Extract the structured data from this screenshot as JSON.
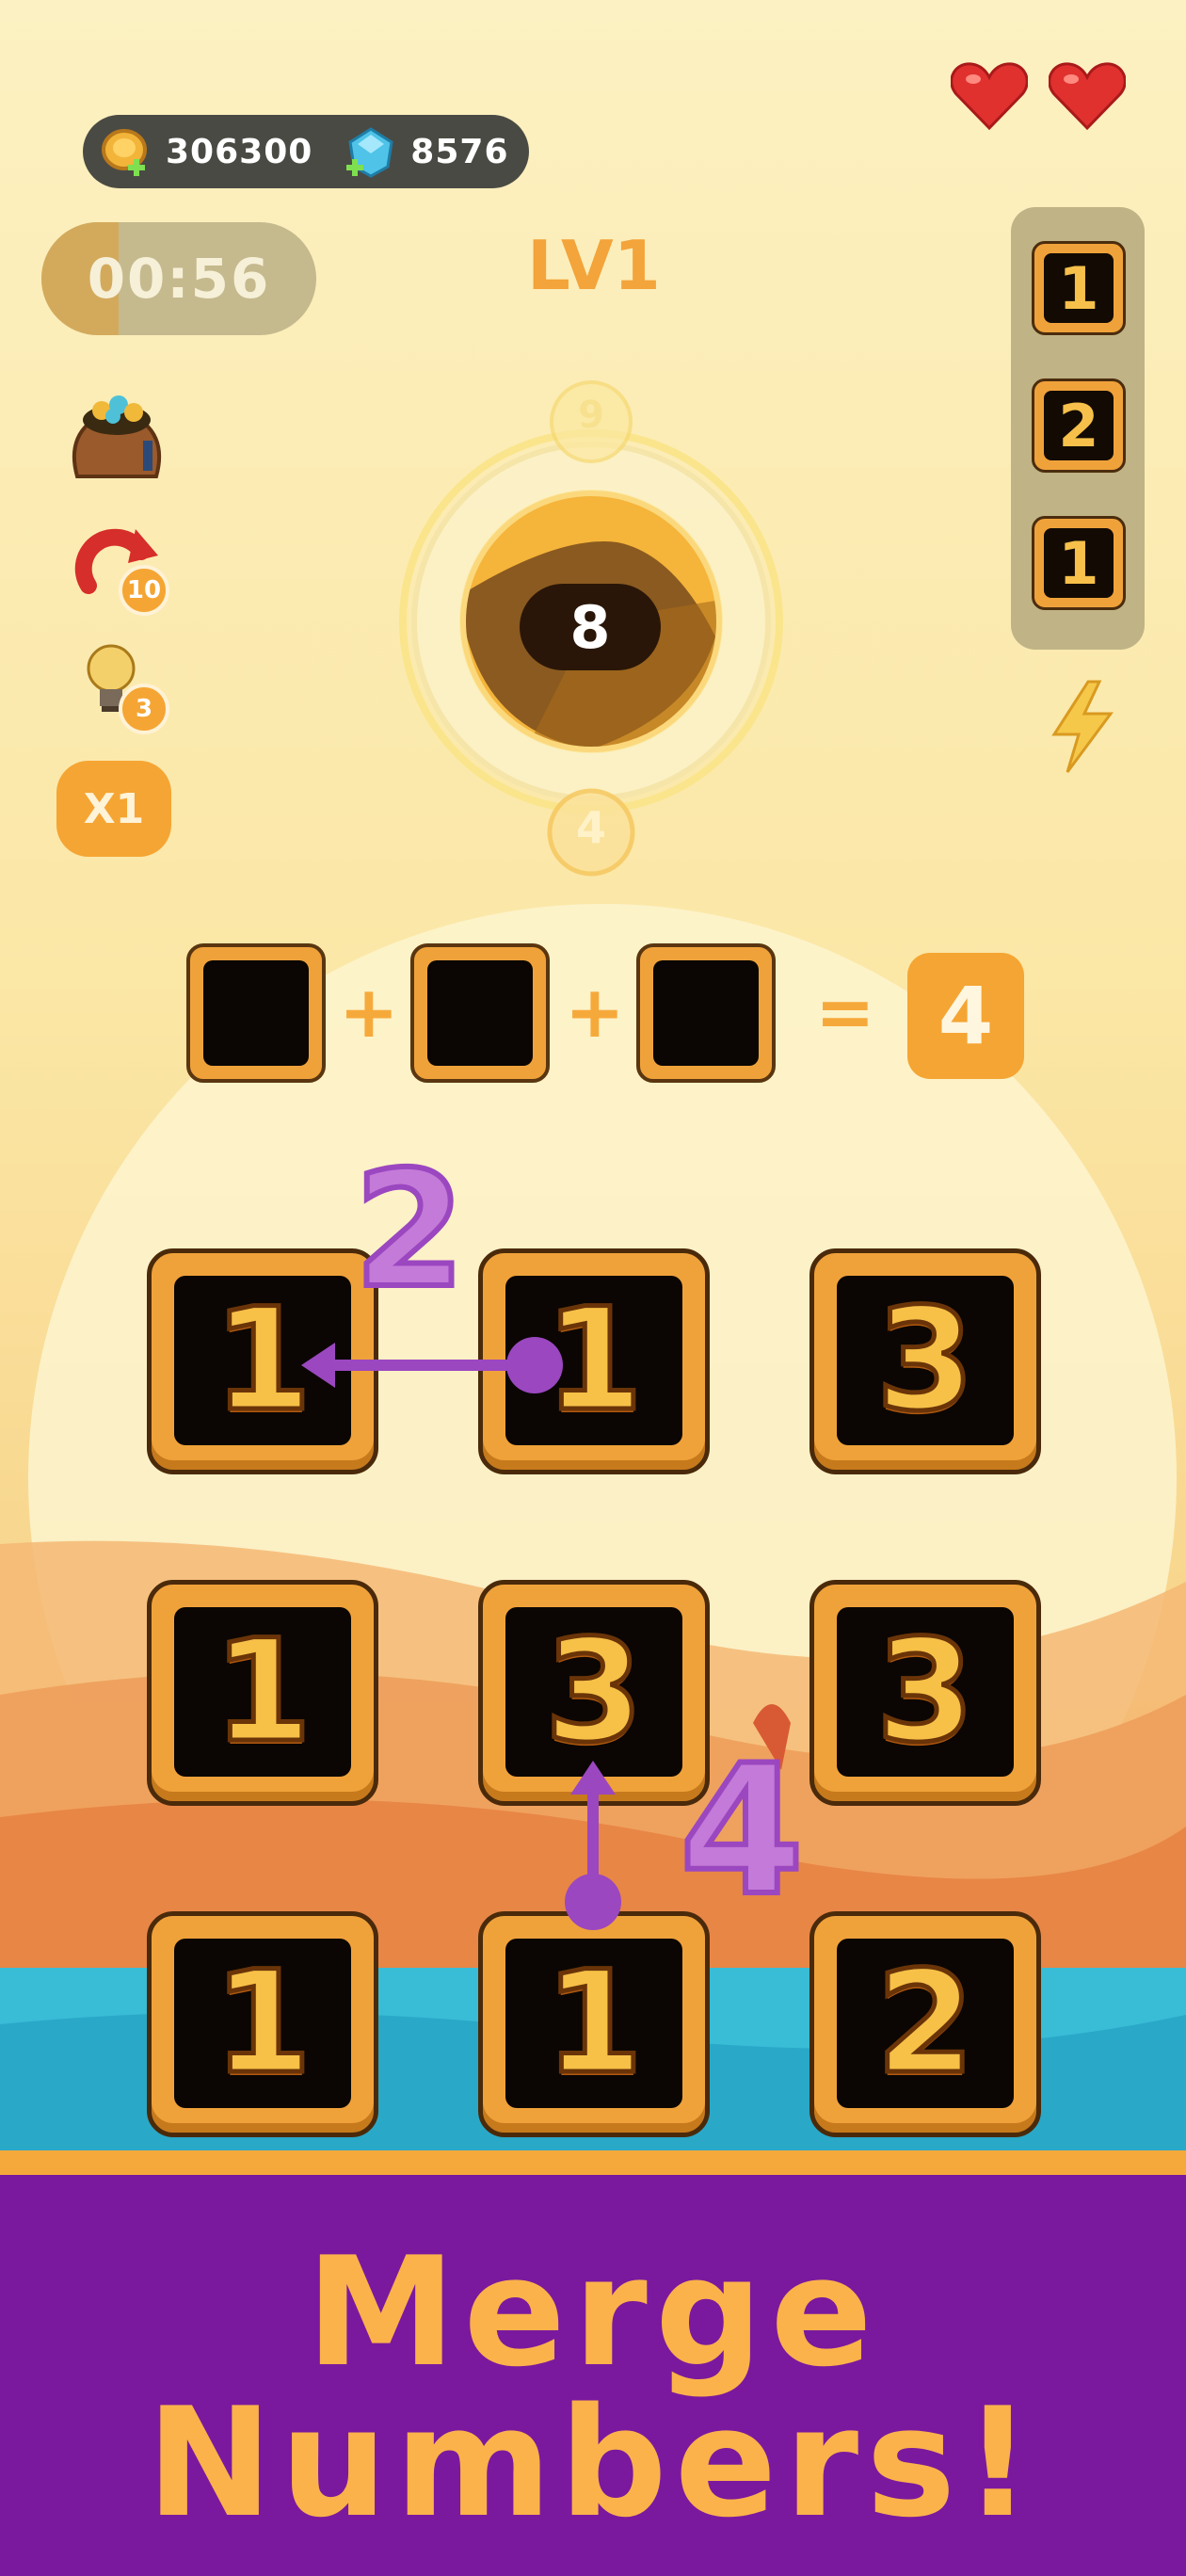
{
  "hud": {
    "coins": "306300",
    "gems": "8576",
    "timer": "00:56",
    "timer_progress": 0.28,
    "level": "LV1",
    "lives": 2
  },
  "powerups": {
    "bag_icon": "treasure-bag-icon",
    "undo_icon": "undo-arrow-icon",
    "undo_count": "10",
    "hint_icon": "lightbulb-icon",
    "hint_count": "3",
    "multiplier": "X1"
  },
  "dial": {
    "target": "8",
    "top_hint": "9",
    "bottom_hint": "4"
  },
  "side_queue": [
    "1",
    "2",
    "1"
  ],
  "equation": {
    "op1": "+",
    "op2": "+",
    "equals": "=",
    "result": "4"
  },
  "grid": [
    [
      "1",
      "1",
      "3"
    ],
    [
      "1",
      "3",
      "3"
    ],
    [
      "1",
      "1",
      "2"
    ]
  ],
  "annotations": {
    "merge_top": "2",
    "merge_bottom": "4"
  },
  "banner": {
    "line1": "Merge",
    "line2": "Numbers!"
  },
  "colors": {
    "accent_orange": "#f0a23a",
    "banner_purple": "#7a199e",
    "annotation_purple": "#9b47c0"
  }
}
